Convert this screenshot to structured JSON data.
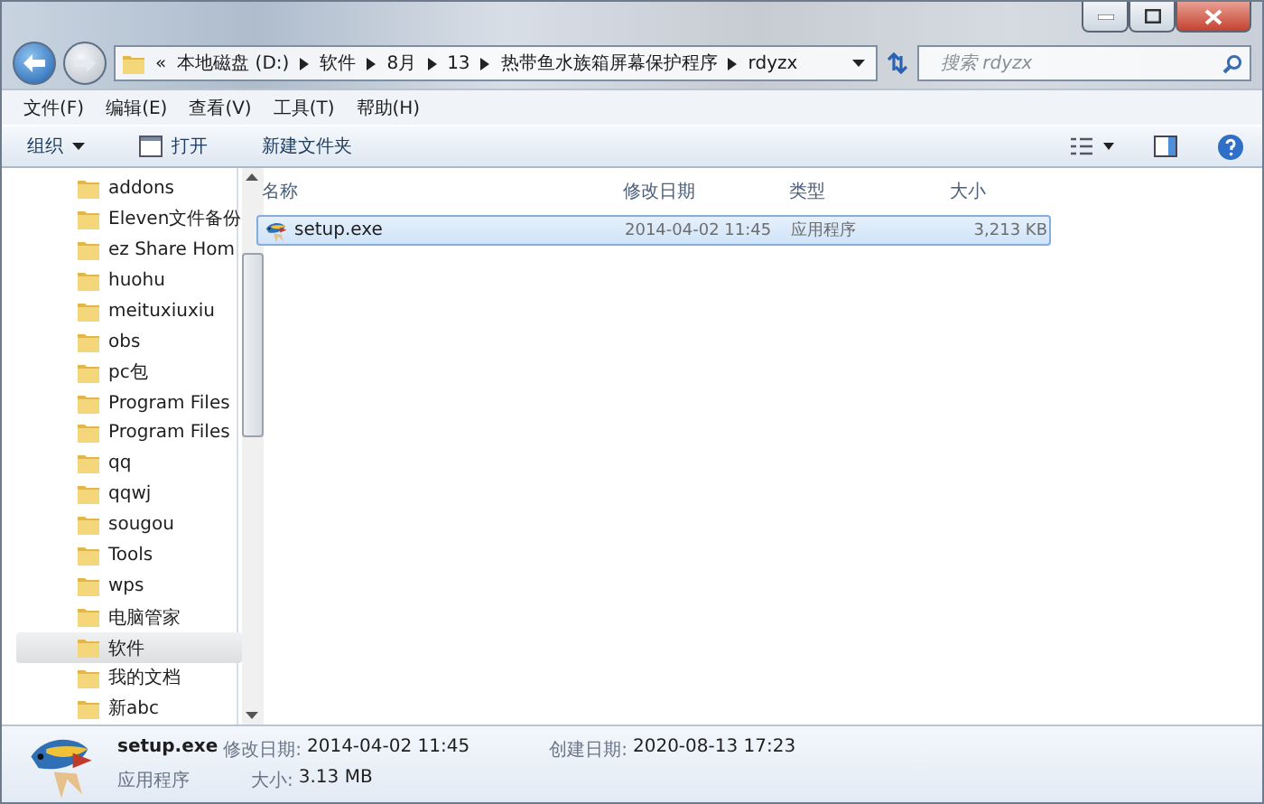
{
  "address": {
    "overflow": "«",
    "crumbs": [
      "本地磁盘 (D:)",
      "软件",
      "8月",
      "13",
      "热带鱼水族箱屏幕保护程序",
      "rdyzx"
    ]
  },
  "search": {
    "placeholder": "搜索 rdyzx"
  },
  "menu": [
    "文件(F)",
    "编辑(E)",
    "查看(V)",
    "工具(T)",
    "帮助(H)"
  ],
  "toolbar": [
    {
      "kind": "dropdown",
      "label": "组织"
    },
    {
      "kind": "open",
      "label": "打开"
    },
    {
      "kind": "plain",
      "label": "新建文件夹"
    }
  ],
  "tree": [
    {
      "label": "addons",
      "selected": false
    },
    {
      "label": "Eleven文件备份",
      "selected": false
    },
    {
      "label": "ez Share Hom",
      "selected": false
    },
    {
      "label": "huohu",
      "selected": false
    },
    {
      "label": "meituxiuxiu",
      "selected": false
    },
    {
      "label": "obs",
      "selected": false
    },
    {
      "label": "pc包",
      "selected": false
    },
    {
      "label": "Program Files",
      "selected": false
    },
    {
      "label": "Program Files",
      "selected": false
    },
    {
      "label": "qq",
      "selected": false
    },
    {
      "label": "qqwj",
      "selected": false
    },
    {
      "label": "sougou",
      "selected": false
    },
    {
      "label": "Tools",
      "selected": false
    },
    {
      "label": "wps",
      "selected": false
    },
    {
      "label": "电脑管家",
      "selected": false
    },
    {
      "label": "软件",
      "selected": true
    },
    {
      "label": "我的文档",
      "selected": false
    },
    {
      "label": "新abc",
      "selected": false
    }
  ],
  "table": {
    "columns": [
      "名称",
      "修改日期",
      "类型",
      "大小"
    ],
    "rows": [
      {
        "name": "setup.exe",
        "modified": "2014-04-02 11:45",
        "type": "应用程序",
        "size": "3,213 KB",
        "selected": true
      }
    ]
  },
  "details": {
    "name": "setup.exe",
    "type": "应用程序",
    "fields": [
      {
        "label": "修改日期:",
        "value": "2014-04-02 11:45"
      },
      {
        "label": "创建日期:",
        "value": "2020-08-13 17:23"
      },
      {
        "label": "大小:",
        "value": "3.13 MB"
      }
    ]
  }
}
